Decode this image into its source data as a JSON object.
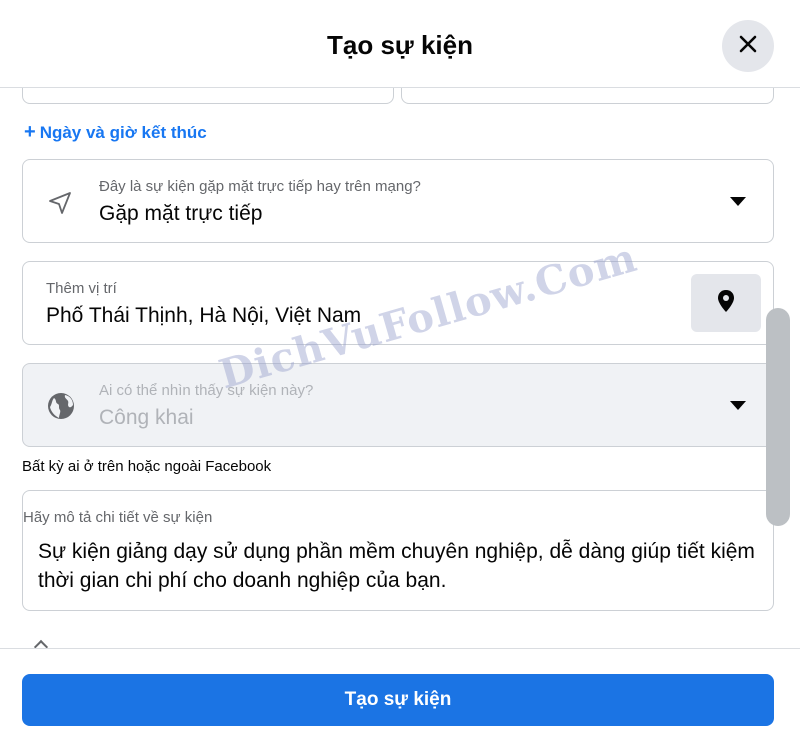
{
  "dialog": {
    "title": "Tạo sự kiện",
    "close_icon": "close-icon"
  },
  "form": {
    "add_end_time": "Ngày và giờ kết thúc",
    "event_type": {
      "label": "Đây là sự kiện gặp mặt trực tiếp hay trên mạng?",
      "value": "Gặp mặt trực tiếp",
      "icon": "location-arrow-icon"
    },
    "location": {
      "label": "Thêm vị trí",
      "value": "Phố Thái Thịnh, Hà Nội, Việt Nam",
      "icon": "map-pin-icon"
    },
    "privacy": {
      "label": "Ai có thể nhìn thấy sự kiện này?",
      "value": "Công khai",
      "icon": "globe-icon",
      "helper": "Bất kỳ ai ở trên hoặc ngoài Facebook"
    },
    "description": {
      "label": "Hãy mô tả chi tiết về sự kiện",
      "value": "Sự kiện giảng dạy sử dụng phần mềm chuyên nghiệp, dễ dàng giúp tiết kiệm thời gian chi phí cho doanh nghiệp của bạn."
    }
  },
  "footer": {
    "submit_label": "Tạo sự kiện"
  },
  "watermark": "DichVuFollow.Com",
  "colors": {
    "accent": "#1b74e4",
    "link": "#1877f2"
  }
}
